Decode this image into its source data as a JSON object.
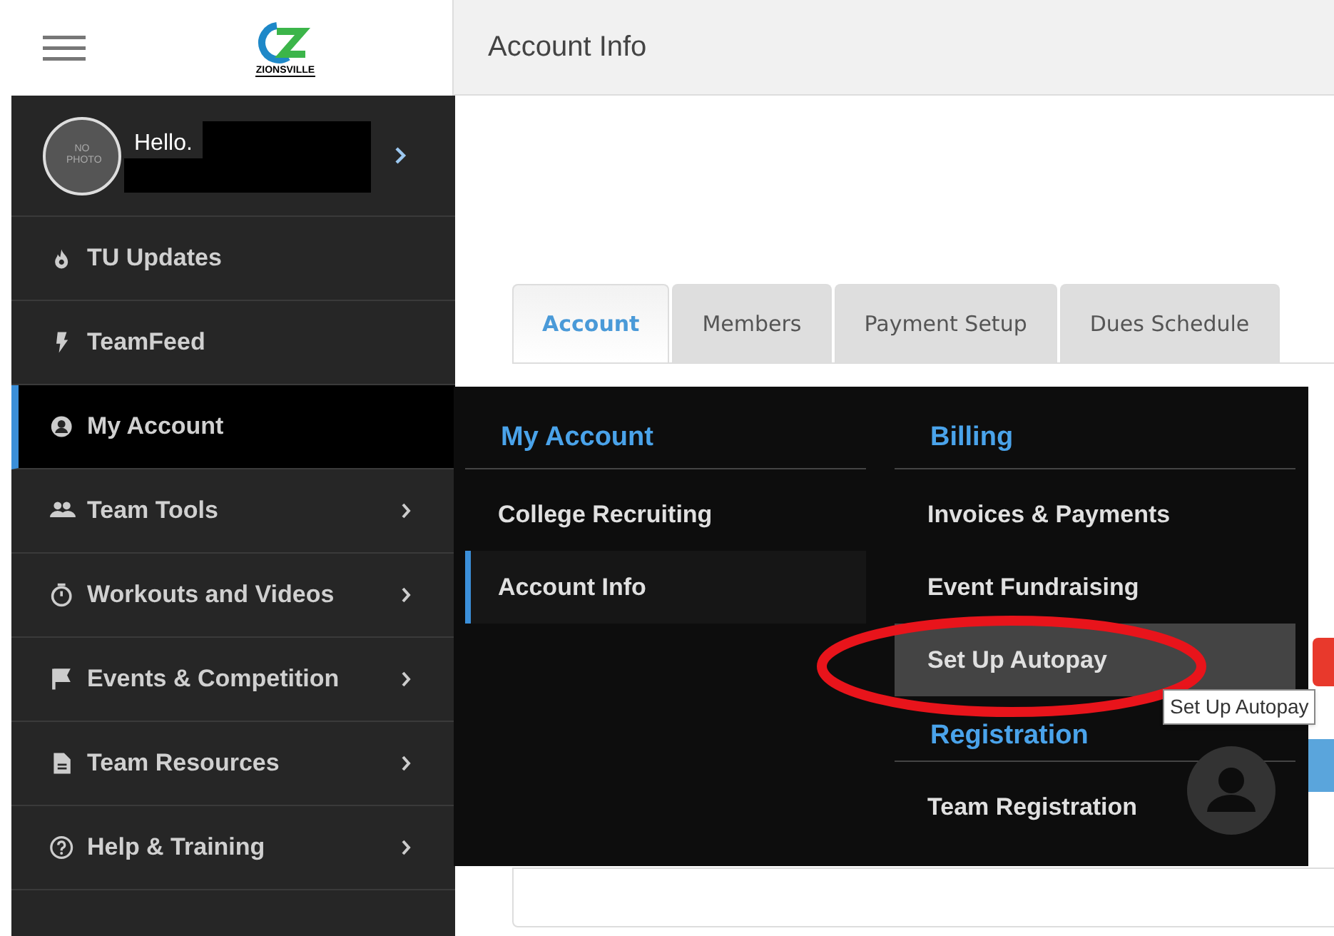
{
  "logo": {
    "text": "ZIONSVILLE"
  },
  "header": {
    "title": "Account Info"
  },
  "profile": {
    "greeting": "Hello.",
    "photo_text": "NO PHOTO"
  },
  "sidebar": {
    "items": [
      {
        "label": "TU Updates",
        "kind": "flame",
        "has_submenu": false,
        "selected": false
      },
      {
        "label": "TeamFeed",
        "kind": "bolt",
        "has_submenu": false,
        "selected": false
      },
      {
        "label": "My Account",
        "kind": "account",
        "has_submenu": false,
        "selected": true
      },
      {
        "label": "Team Tools",
        "kind": "group",
        "has_submenu": true,
        "selected": false
      },
      {
        "label": "Workouts and Videos",
        "kind": "timer",
        "has_submenu": true,
        "selected": false
      },
      {
        "label": "Events & Competition",
        "kind": "flag",
        "has_submenu": true,
        "selected": false
      },
      {
        "label": "Team Resources",
        "kind": "document",
        "has_submenu": true,
        "selected": false
      },
      {
        "label": "Help & Training",
        "kind": "help",
        "has_submenu": true,
        "selected": false
      }
    ]
  },
  "tabs": [
    {
      "label": "Account",
      "selected": true
    },
    {
      "label": "Members",
      "selected": false
    },
    {
      "label": "Payment Setup",
      "selected": false
    },
    {
      "label": "Dues Schedule",
      "selected": false
    }
  ],
  "mega_menu": {
    "columns": [
      {
        "sections": [
          {
            "heading": "My Account",
            "items": [
              {
                "label": "College Recruiting",
                "selected": false,
                "hovered": false
              },
              {
                "label": "Account Info",
                "selected": true,
                "hovered": false
              }
            ]
          }
        ]
      },
      {
        "sections": [
          {
            "heading": "Billing",
            "items": [
              {
                "label": "Invoices & Payments",
                "selected": false,
                "hovered": false
              },
              {
                "label": "Event Fundraising",
                "selected": false,
                "hovered": false
              },
              {
                "label": "Set Up Autopay",
                "selected": false,
                "hovered": true
              }
            ]
          },
          {
            "heading": "Registration",
            "items": [
              {
                "label": "Team Registration",
                "selected": false,
                "hovered": false
              }
            ]
          }
        ]
      }
    ]
  },
  "tooltip": {
    "text": "Set Up Autopay"
  }
}
